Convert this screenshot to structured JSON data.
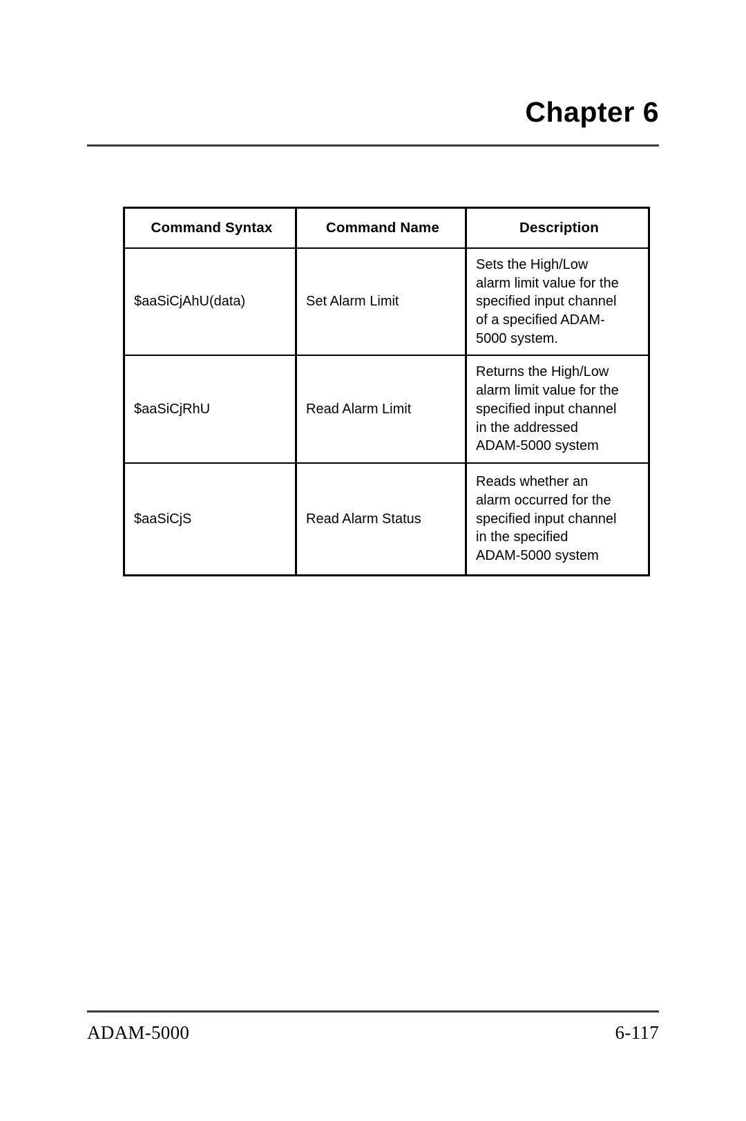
{
  "header": {
    "chapter_title": "Chapter 6"
  },
  "table": {
    "columns": [
      "Command Syntax",
      "Command Name",
      "Description"
    ],
    "rows": [
      {
        "syntax": "$aaSiCjAhU(data)",
        "name": "Set Alarm Limit",
        "description": "Sets the High/Low\nalarm limit value for the\nspecified input channel\nof a specified ADAM-\n5000 system."
      },
      {
        "syntax": "$aaSiCjRhU",
        "name": "Read Alarm Limit",
        "description": "Returns the High/Low\nalarm limit value for the\nspecified input channel\nin the addressed\nADAM-5000 system"
      },
      {
        "syntax": "$aaSiCjS",
        "name": "Read Alarm Status",
        "description": "Reads whether an\nalarm occurred for the\nspecified input channel\nin the specified\nADAM-5000 system"
      }
    ]
  },
  "footer": {
    "product": "ADAM-5000",
    "page_number": "6-117"
  }
}
